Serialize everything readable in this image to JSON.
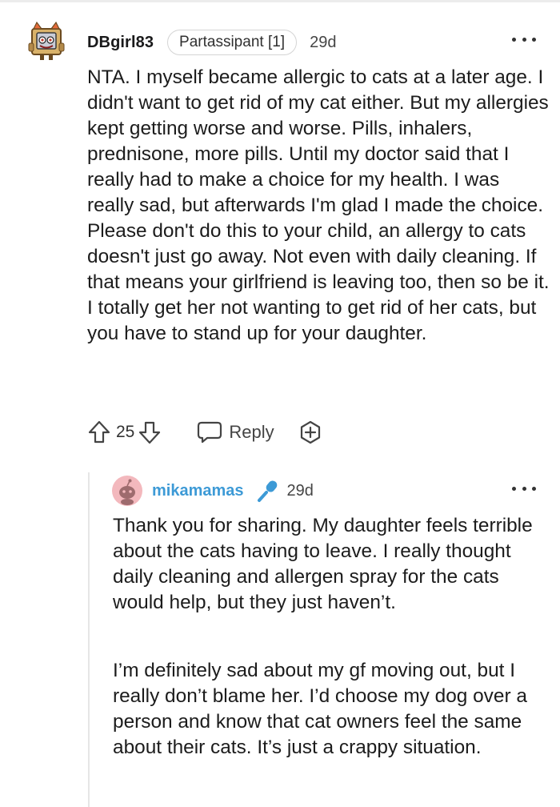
{
  "comment1": {
    "username": "DBgirl83",
    "flair": "Partassipant [1]",
    "age": "29d",
    "body": "NTA. I myself became allergic to cats at a later age. I didn't want to get rid of my cat either. But my allergies kept getting worse and worse. Pills, inhalers, prednisone, more pills. Until my doctor said that I really had to make a choice for my health. I was really sad, but afterwards I'm glad I made the choice. Please don't do this to your child, an allergy to cats doesn't just go away. Not even with daily cleaning. If that means your girlfriend is leaving too, then so be it. I totally get her not wanting to get rid of her cats, but you have to stand up for your daughter.",
    "votes": "25",
    "reply_label": "Reply",
    "icons": {
      "avatar": "snoo-avatar-icon",
      "more": "more-options-icon",
      "upvote": "upvote-arrow-icon",
      "downvote": "downvote-arrow-icon",
      "reply": "speech-bubble-icon",
      "award": "award-plus-icon"
    }
  },
  "comment2": {
    "username": "mikamamas",
    "age": "29d",
    "paragraphs": [
      "Thank you for sharing. My daughter feels terrible about the cats having to leave. I really thought daily cleaning and allergen spray for the cats would help, but they just haven’t.",
      "I’m definitely sad about my gf moving out, but I really don’t blame her. I’d choose my dog over a person and know that cat owners feel the same about their cats. It’s just a crappy situation."
    ],
    "icons": {
      "avatar": "snoo-avatar-icon",
      "op_badge": "microphone-icon",
      "more": "more-options-icon"
    }
  },
  "colors": {
    "op_username": "#3d9ad6",
    "text": "#1c1c1c",
    "muted": "#454545",
    "thread_line": "#e6e6e6"
  }
}
